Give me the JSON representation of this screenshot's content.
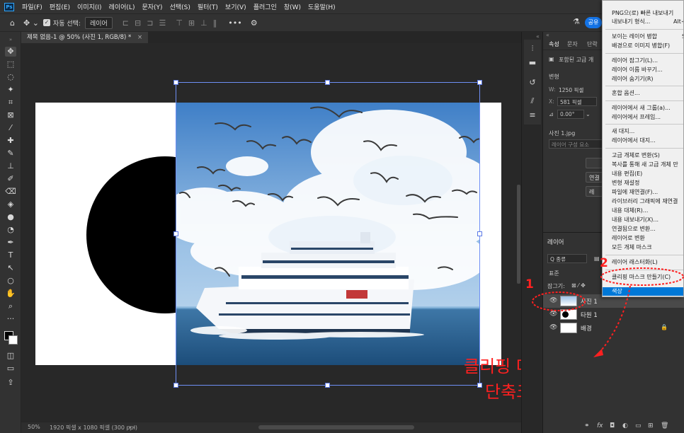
{
  "menubar": {
    "logo": "Ps",
    "items": [
      "파일(F)",
      "편집(E)",
      "이미지(I)",
      "레이어(L)",
      "문자(Y)",
      "선택(S)",
      "필터(T)",
      "보기(V)",
      "플러그인",
      "창(W)",
      "도움말(H)"
    ]
  },
  "options": {
    "auto_select_label": "자동 선택:",
    "auto_select_value": "레이어",
    "share_label": "공유"
  },
  "document": {
    "tab_title": "제목 없음-1 @ 50% (사진 1, RGB/8) *",
    "close_glyph": "×"
  },
  "status": {
    "zoom": "50%",
    "info": "1920 픽셀 x 1080 픽셀 (300 ppi)"
  },
  "properties": {
    "tabs": [
      "속성",
      "문자",
      "단락"
    ],
    "layer_kind": "포함된 고급 개",
    "section_transform": "변형",
    "w_label": "W:",
    "w_value": "1250 픽셀",
    "x_label": "X:",
    "x_value": "581 픽셀",
    "angle_value": "0.00°",
    "file_name": "사진 1.jpg",
    "comp_placeholder": "레이어 구성 요소",
    "btn_link": "연결",
    "btn_third": "레"
  },
  "layers": {
    "title": "레이어",
    "filter_label": "Q 종류",
    "blend_mode": "표준",
    "lock_label": "잠그기:",
    "rows": [
      {
        "name": "사진 1"
      },
      {
        "name": "타원 1"
      },
      {
        "name": "배경"
      }
    ]
  },
  "context_menu": {
    "items": [
      {
        "label": "PNG으(로) 빠른 내보내기",
        "shortcut": ""
      },
      {
        "label": "내보내기 형식...",
        "shortcut": "Alt+"
      },
      {
        "label": "보이는 레이어 병합",
        "shortcut": "S"
      },
      {
        "label": "배경으로 이미지 병합(F)",
        "shortcut": ""
      },
      {
        "label": "레이어 잠그기(L)...",
        "shortcut": ""
      },
      {
        "label": "레이어 이름 바꾸기...",
        "shortcut": ""
      },
      {
        "label": "레이어 숨기기(R)",
        "shortcut": ""
      },
      {
        "label": "혼합 옵션...",
        "shortcut": ""
      },
      {
        "label": "레이어에서 새 그룹(a)...",
        "shortcut": ""
      },
      {
        "label": "레이어에서 프레임...",
        "shortcut": ""
      },
      {
        "label": "새 대지...",
        "shortcut": ""
      },
      {
        "label": "레이어에서 대지...",
        "shortcut": ""
      },
      {
        "label": "고급 개체로 변환(S)",
        "shortcut": ""
      },
      {
        "label": "복사를 통해 새 고급 개체 만",
        "shortcut": ""
      },
      {
        "label": "내용 편집(E)",
        "shortcut": ""
      },
      {
        "label": "변형 재설정",
        "shortcut": ""
      },
      {
        "label": "파일에 재연결(F)...",
        "shortcut": ""
      },
      {
        "label": "라이브러리 그래픽에 재연결",
        "shortcut": ""
      },
      {
        "label": "내용 대체(R)...",
        "shortcut": ""
      },
      {
        "label": "내용 내보내기(X)...",
        "shortcut": ""
      },
      {
        "label": "연결됨으로 변환...",
        "shortcut": ""
      },
      {
        "label": "레이어로 변환",
        "shortcut": ""
      },
      {
        "label": "모든 개체 마스크",
        "shortcut": ""
      },
      {
        "label": "레이어 래스터화(L)",
        "shortcut": ""
      },
      {
        "label": "클리핑 마스크 만들기(C)",
        "shortcut": ""
      },
      {
        "label": "색상",
        "shortcut": ""
      }
    ]
  },
  "annotations": {
    "title": "클리핑 마스크 만들기",
    "shortcut": "단축크 Ctrl+Alt+G",
    "step1": "1",
    "step2": "2",
    "color": "#ff2020"
  },
  "colors": {
    "accent": "#1473e6",
    "highlight": "#0078d7",
    "selection": "#6f8ff5"
  }
}
